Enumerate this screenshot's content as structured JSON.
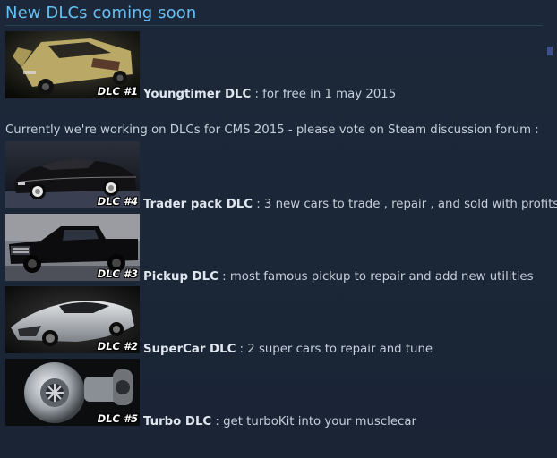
{
  "section": {
    "title": "New DLCs coming soon"
  },
  "notice": "Currently we're working on DLCs for CMS 2015 - please vote on Steam discussion forum :",
  "entries": [
    {
      "tag": "DLC #1",
      "name": "Youngtimer DLC",
      "description": " : for free in 1 may 2015",
      "image_icon": "youngtimer-car-image",
      "accent": "#c8b774"
    },
    {
      "tag": "DLC #4",
      "name": "Trader pack DLC",
      "description": " : 3 new cars to trade , repair , and sold with profits",
      "image_icon": "classic-convertible-image",
      "accent": "#1a1a1a"
    },
    {
      "tag": "DLC #3",
      "name": "Pickup DLC",
      "description": " : most famous pickup to repair and add new utilities",
      "image_icon": "pickup-truck-image",
      "accent": "#111111"
    },
    {
      "tag": "DLC #2",
      "name": "SuperCar DLC",
      "description": " : 2 super cars to repair and tune",
      "image_icon": "supercar-image",
      "accent": "#a8adb2"
    },
    {
      "tag": "DLC #5",
      "name": "Turbo DLC",
      "description": " : get turboKit into your musclecar",
      "image_icon": "turbocharger-image",
      "accent": "#b9bec4"
    }
  ],
  "colors": {
    "background": "#1b2637",
    "title": "#66c0f4",
    "text": "#c6cfd9"
  }
}
